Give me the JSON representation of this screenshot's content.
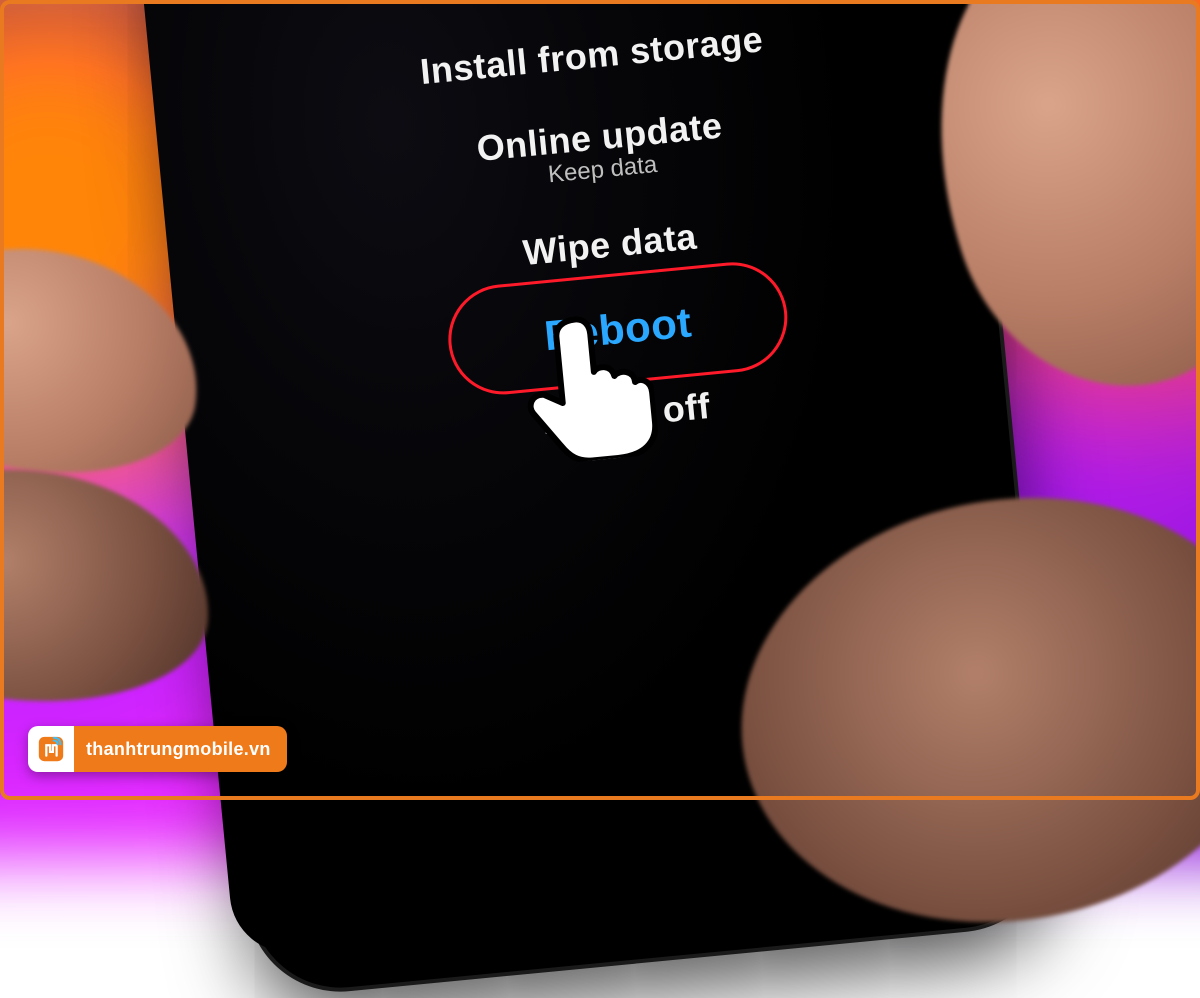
{
  "menu": {
    "install": {
      "label": "Install from storage"
    },
    "onlineupdate": {
      "label": "Online update",
      "sub": "Keep data"
    },
    "wipe": {
      "label": "Wipe data"
    },
    "reboot": {
      "label": "Reboot"
    },
    "poweroff": {
      "label": "Power off"
    }
  },
  "annotation": {
    "highlight_color": "#ff1a2a",
    "selected_color": "#2aa8ff"
  },
  "watermark": {
    "text": "thanhtrungmobile.vn",
    "brand_color": "#ef7a1a"
  }
}
